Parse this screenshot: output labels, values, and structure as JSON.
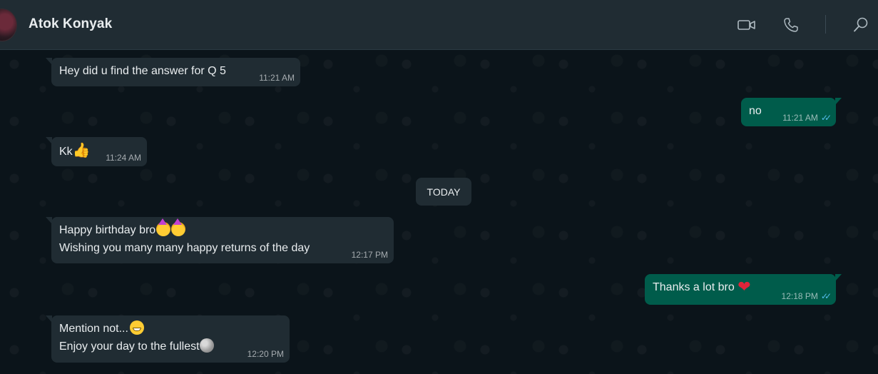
{
  "header": {
    "contact_name": "Atok Konyak",
    "icons": [
      "video-call-icon",
      "voice-call-icon",
      "search-icon"
    ]
  },
  "date_separator": "TODAY",
  "messages": [
    {
      "direction": "in",
      "lines": [
        "Hey did u find the answer for Q 5"
      ],
      "time": "11:21 AM"
    },
    {
      "direction": "out",
      "lines": [
        "no"
      ],
      "time": "11:21 AM",
      "read": true
    },
    {
      "direction": "in",
      "lines": [
        "Kk"
      ],
      "emoji": "thumbs-up",
      "time": "11:24 AM"
    },
    {
      "direction": "in",
      "lines": [
        "Happy birthday bro",
        "Wishing you many many happy returns of the day"
      ],
      "emoji": "partying-face",
      "time": "12:17 PM"
    },
    {
      "direction": "out",
      "lines": [
        "Thanks a lot bro"
      ],
      "emoji": "red-heart",
      "time": "12:18 PM",
      "read": true
    },
    {
      "direction": "in",
      "lines": [
        "Mention not...",
        "Enjoy your day to the fullest"
      ],
      "emoji": "grinning-face",
      "emoji2": "full-moon-face",
      "time": "12:20 PM"
    }
  ],
  "colors": {
    "header_bg": "#202c33",
    "chat_bg": "#0b141a",
    "incoming_bubble": "#202c33",
    "outgoing_bubble": "#005c4b",
    "read_ticks": "#53bdeb"
  }
}
